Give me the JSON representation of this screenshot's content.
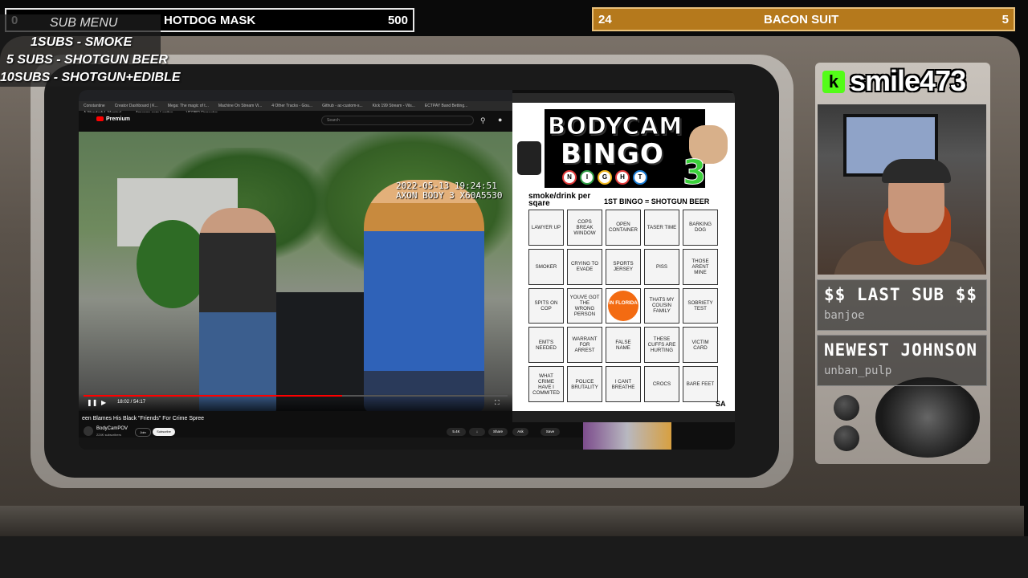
{
  "goal_left": {
    "start": "0",
    "title": "HOTDOG MASK",
    "target": "500"
  },
  "goal_right": {
    "start": "24",
    "title": "BACON SUIT",
    "target": "5"
  },
  "submenu": {
    "title": "SUB MENU",
    "lines": [
      "1SUBS   - SMOKE",
      "5 SUBS  - SHOTGUN BEER",
      "10SUBS - SHOTGUN+EDIBLE"
    ]
  },
  "browser": {
    "search_placeholder": "Search",
    "premium_label": "Premium",
    "bookmarks": [
      "Constantine",
      "Creator Dashboard | K...",
      "Mega: The magic of t...",
      "Machine On Stream Vi...",
      "4 Other Tracks - Gou...",
      "Github - ac-custom-s...",
      "Kick 199 Stream - Vils...",
      "ECTPAY Band Betting...",
      "A Wonderful, Magical ...",
      "Amazon.com Logitec...",
      "VERBR Repeater"
    ]
  },
  "video": {
    "timestamp_line1": "2022-05-13 19:24:51",
    "timestamp_line2": "AXON BODY 3 X60A5530",
    "time_display": "18:02 / 54:17",
    "progress_fraction": 0.61,
    "title": "een Blames His Black \"Friends\" For Crime Spree",
    "channel": "BodyCamPOV",
    "subscribers": "224K subscribers",
    "join_label": "Join",
    "subscribe_label": "Subscribe",
    "actions": [
      "5.4K",
      "Share",
      "Ask",
      "Save"
    ]
  },
  "bingo": {
    "title_line1": "BODYCAM",
    "title_line2": "BINGO",
    "night_letters": [
      "N",
      "I",
      "G",
      "H",
      "T"
    ],
    "night_colors": [
      "#e23b3b",
      "#2f9e44",
      "#f2b81d",
      "#e23b3b",
      "#1c7ed6"
    ],
    "number": "3",
    "per_square": "smoke/drink per sqare",
    "first_bingo": "1ST BINGO = SHOTGUN BEER",
    "cells": [
      "LAWYER UP",
      "COPS BREAK WINDOW",
      "OPEN CONTAINER",
      "TASER TIME",
      "BARKING DOG",
      "SMOKER",
      "CRYING TO EVADE",
      "SPORTS JERSEY",
      "PISS",
      "THOSE ARENT MINE",
      "SPITS ON COP",
      "YOUVE GOT THE WRONG PERSON",
      "IN FLORIDA",
      "THATS MY COUSIN FAMILY",
      "SOBRIETY TEST",
      "EMT'S NEEDED",
      "WARRANT FOR ARREST",
      "FALSE NAME",
      "THESE CUFFS ARE HURTING",
      "VICTIM CARD",
      "WHAT CRIME HAVE I COMMITED",
      "POLICE BRUTALITY",
      "I CANT BREATHE",
      "CROCS",
      "BARE FEET"
    ],
    "corner_label": "SA"
  },
  "streamer": {
    "handle": "smile473",
    "kick_icon": "k"
  },
  "last_sub": {
    "title": "$$ LAST SUB $$",
    "value": "banjoe"
  },
  "newest": {
    "title": "NEWEST JOHNSON",
    "value": "unban_pulp"
  }
}
